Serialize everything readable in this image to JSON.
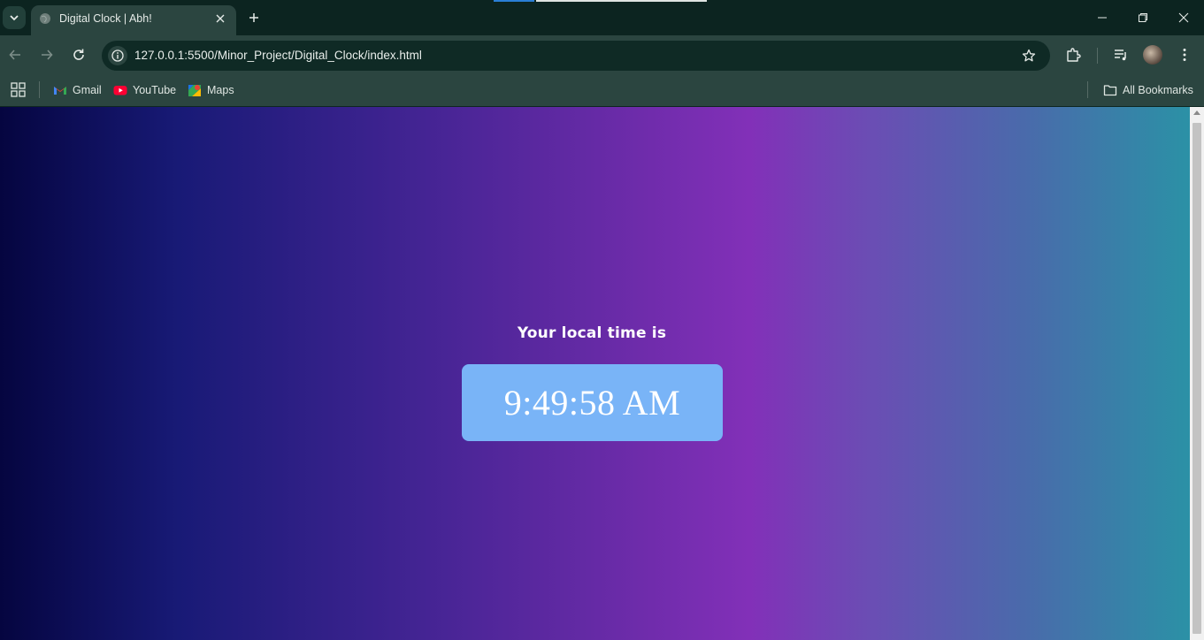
{
  "browser": {
    "tab": {
      "title": "Digital Clock | Abh!"
    },
    "address_bar": {
      "url": "127.0.0.1:5500/Minor_Project/Digital_Clock/index.html"
    },
    "bookmarks": [
      {
        "label": "Gmail",
        "icon": "gmail-icon"
      },
      {
        "label": "YouTube",
        "icon": "youtube-icon"
      },
      {
        "label": "Maps",
        "icon": "maps-icon"
      }
    ],
    "all_bookmarks_label": "All Bookmarks"
  },
  "page": {
    "heading": "Your local time is",
    "time": "9:49:58 AM",
    "colors": {
      "clock_box": "#79b4f7",
      "gradient": [
        "#050540",
        "#181a76",
        "#3e2390",
        "#6a2ba8",
        "#8230b8",
        "#6b4db4",
        "#4a6aab",
        "#2b91a6"
      ]
    }
  }
}
